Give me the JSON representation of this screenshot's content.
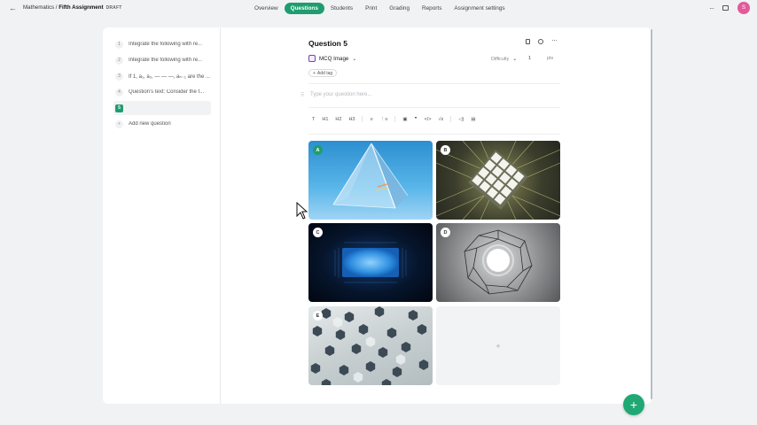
{
  "header": {
    "breadcrumb_subject": "Mathematics",
    "breadcrumb_sep": " / ",
    "breadcrumb_assignment": "Fifth Assignment",
    "status": "DRAFT",
    "tabs": [
      {
        "label": "Overview",
        "active": false
      },
      {
        "label": "Questions",
        "active": true
      },
      {
        "label": "Students",
        "active": false
      },
      {
        "label": "Print",
        "active": false
      },
      {
        "label": "Grading",
        "active": false
      },
      {
        "label": "Reports",
        "active": false
      },
      {
        "label": "Assignment settings",
        "active": false
      }
    ],
    "avatar_initial": "S"
  },
  "sidebar": {
    "items": [
      {
        "num": "1",
        "label": "Integrate the following with re..."
      },
      {
        "num": "2",
        "label": "Integrate the following with re..."
      },
      {
        "num": "3",
        "label": "If 1, a₁, a₂, — — —, aₙ₋₁ are the ..."
      },
      {
        "num": "4",
        "label": "Question's text: Consider the f..."
      },
      {
        "num": "5",
        "label": ""
      }
    ],
    "add_num": "+",
    "add_label": "Add new question"
  },
  "question": {
    "title": "Question 5",
    "type_label": "MCQ Image",
    "difficulty_label": "Difficulty",
    "points_value": "1",
    "points_label": "pts",
    "add_tag_label": "Add tag",
    "placeholder": "Type your question here...",
    "toolbar": [
      "T",
      "H1",
      "H2",
      "H3",
      "≡",
      "⋮≡",
      "▣",
      "❞",
      "</>",
      "√x",
      "◁)",
      "▤"
    ],
    "options": [
      {
        "letter": "A",
        "selected": true
      },
      {
        "letter": "B",
        "selected": false
      },
      {
        "letter": "C",
        "selected": false
      },
      {
        "letter": "D",
        "selected": false
      },
      {
        "letter": "E",
        "selected": false
      }
    ],
    "add_option_symbol": "+"
  },
  "colors": {
    "accent": "#1f9d6f",
    "avatar": "#e25a9a"
  }
}
